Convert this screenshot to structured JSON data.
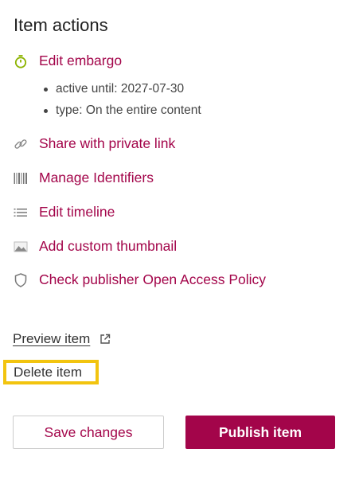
{
  "title": "Item actions",
  "colors": {
    "accent": "#a3054a",
    "embargo_icon": "#8cb300",
    "highlight": "#f2c40f"
  },
  "actions": [
    {
      "label": "Edit embargo",
      "icon": "stopwatch-icon"
    },
    {
      "label": "Share with private link",
      "icon": "link-icon"
    },
    {
      "label": "Manage Identifiers",
      "icon": "barcode-icon"
    },
    {
      "label": "Edit timeline",
      "icon": "list-icon"
    },
    {
      "label": "Add custom thumbnail",
      "icon": "image-icon"
    },
    {
      "label": "Check publisher Open Access Policy",
      "icon": "shield-icon"
    }
  ],
  "embargo_details": [
    "active until: 2027-07-30",
    "type: On the entire content"
  ],
  "preview_label": "Preview item",
  "delete_label": "Delete item",
  "buttons": {
    "save": "Save changes",
    "publish": "Publish item"
  }
}
